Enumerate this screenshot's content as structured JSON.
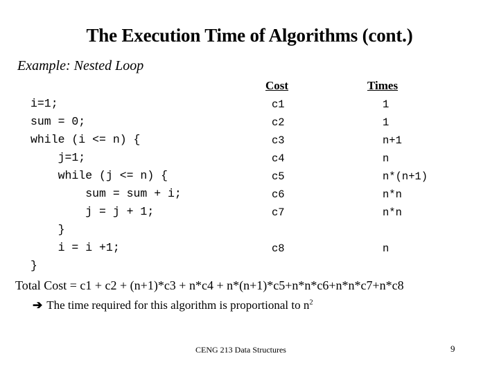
{
  "slide": {
    "title": "The Execution Time of Algorithms (cont.)",
    "example_label": "Example:",
    "example_text": "Nested Loop",
    "example_line": "Example: Nested Loop"
  },
  "table": {
    "headers": {
      "code": "",
      "cost": "Cost",
      "times": "Times"
    },
    "rows": [
      {
        "code": "i=1;",
        "cost": "c1",
        "times": "1"
      },
      {
        "code": "sum = 0;",
        "cost": "c2",
        "times": "1"
      },
      {
        "code": "while (i <= n) {",
        "cost": "c3",
        "times": "n+1"
      },
      {
        "code": "    j=1;",
        "cost": "c4",
        "times": "n"
      },
      {
        "code": "    while (j <= n) {",
        "cost": "c5",
        "times": "n*(n+1)"
      },
      {
        "code": "        sum = sum + i;",
        "cost": "c6",
        "times": "n*n"
      },
      {
        "code": "        j = j + 1;",
        "cost": "c7",
        "times": "n*n"
      },
      {
        "code": "    }",
        "cost": "",
        "times": ""
      },
      {
        "code": "    i = i +1;",
        "cost": "c8",
        "times": "n"
      },
      {
        "code": "}",
        "cost": "",
        "times": ""
      }
    ]
  },
  "total_cost": {
    "text": "Total Cost =  c1 + c2 + (n+1)*c3 + n*c4 + n*(n+1)*c5+n*n*c6+n*n*c7+n*c8"
  },
  "conclusion": {
    "arrow": "➔",
    "text_before": "The time required for this algorithm is proportional to n",
    "exponent": "2"
  },
  "footer": {
    "course": "CENG 213 Data Structures",
    "page_number": "9"
  },
  "colors": {
    "background": "#ffffff",
    "text": "#000000"
  }
}
